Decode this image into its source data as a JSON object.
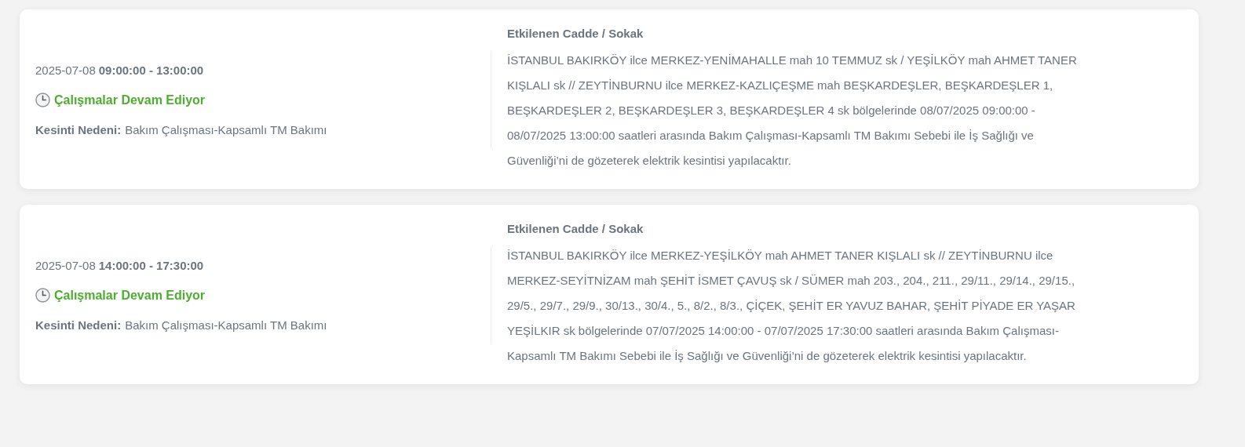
{
  "outages": [
    {
      "date": "2025-07-08",
      "time": "09:00:00 - 13:00:00",
      "status": {
        "kind": "ongoing",
        "text": "Çalışmalar Devam Ediyor"
      },
      "reason_label": "Kesinti Nedeni:",
      "reason": "Bakım Çalışması-Kapsamlı TM Bakımı",
      "streets_title": "Etkilenen Cadde / Sokak",
      "streets": "İSTANBUL BAKIRKÖY ilce MERKEZ-YENİMAHALLE mah 10 TEMMUZ sk / YEŞİLKÖY mah AHMET TANER KIŞLALI sk // ZEYTİNBURNU ilce MERKEZ-KAZLIÇEŞME mah BEŞKARDEŞLER, BEŞKARDEŞLER 1, BEŞKARDEŞLER 2, BEŞKARDEŞLER 3, BEŞKARDEŞLER 4 sk bölgelerinde 08/07/2025 09:00:00 - 08/07/2025 13:00:00 saatleri arasında Bakım Çalışması-Kapsamlı TM Bakımı Sebebi ile İş Sağlığı ve Güvenliği’ni de gözeterek elektrik kesintisi yapılacaktır."
    },
    {
      "date": "2025-07-08",
      "time": "14:00:00 - 17:30:00",
      "status": {
        "kind": "ongoing",
        "text": "Çalışmalar Devam Ediyor"
      },
      "reason_label": "Kesinti Nedeni:",
      "reason": "Bakım Çalışması-Kapsamlı TM Bakımı",
      "streets_title": "Etkilenen Cadde / Sokak",
      "streets": "İSTANBUL BAKIRKÖY ilce MERKEZ-YEŞİLKÖY mah AHMET TANER KIŞLALI sk // ZEYTİNBURNU ilce MERKEZ-SEYİTNİZAM mah ŞEHİT İSMET ÇAVUŞ sk / SÜMER mah 203., 204., 211., 29/11., 29/14., 29/15., 29/5., 29/7., 29/9., 30/13., 30/4., 5., 8/2., 8/3., ÇİÇEK, ŞEHİT ER YAVUZ BAHAR, ŞEHİT PİYADE ER YAŞAR YEŞİLKIR sk bölgelerinde 07/07/2025 14:00:00 - 07/07/2025 17:30:00 saatleri arasında Bakım Çalışması-Kapsamlı TM Bakımı Sebebi ile İş Sağlığı ve Güvenliği’ni de gözeterek elektrik kesintisi yapılacaktır."
    }
  ]
}
